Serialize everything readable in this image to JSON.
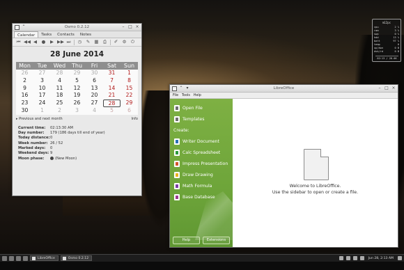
{
  "osmo": {
    "title": "Osmo 0.2.12",
    "tabs": [
      "Calendar",
      "Tasks",
      "Contacts",
      "Notes"
    ],
    "date_heading": "28 June 2014",
    "weekdays": [
      "Mon",
      "Tue",
      "Wed",
      "Thu",
      "Fri",
      "Sat",
      "Sun"
    ],
    "weeks": [
      [
        "26",
        "27",
        "28",
        "29",
        "30",
        "31",
        "1"
      ],
      [
        "2",
        "3",
        "4",
        "5",
        "6",
        "7",
        "8"
      ],
      [
        "9",
        "10",
        "11",
        "12",
        "13",
        "14",
        "15"
      ],
      [
        "16",
        "17",
        "18",
        "19",
        "20",
        "21",
        "22"
      ],
      [
        "23",
        "24",
        "25",
        "26",
        "27",
        "28",
        "29"
      ],
      [
        "30",
        "1",
        "2",
        "3",
        "4",
        "5",
        "6"
      ]
    ],
    "prev_next_label": "Previous and next month",
    "info_label": "Info",
    "info": {
      "current_time_label": "Current time:",
      "current_time": "02:13:30 AM",
      "day_number_label": "Day number:",
      "day_number": "179 (186 days till end of year)",
      "today_distance_label": "Today distance:",
      "today_distance": "0",
      "week_number_label": "Week number:",
      "week_number": "26 / 52",
      "marked_days_label": "Marked days:",
      "marked_days": "0",
      "weekend_days_label": "Weekend days:",
      "weekend_days": "9",
      "moon_phase_label": "Moon phase:",
      "moon_phase": "(New Moon)"
    }
  },
  "libreoffice": {
    "title": "LibreOffice",
    "menu": [
      "File",
      "Tools",
      "Help"
    ],
    "sidebar": {
      "open_file": "Open File",
      "templates": "Templates",
      "create_label": "Create:",
      "items": [
        {
          "label": "Writer Document",
          "color": "#2a6fb6"
        },
        {
          "label": "Calc Spreadsheet",
          "color": "#2b9a3c"
        },
        {
          "label": "Impress Presentation",
          "color": "#d2542b"
        },
        {
          "label": "Draw Drawing",
          "color": "#e6b21e"
        },
        {
          "label": "Math Formula",
          "color": "#7a3fa4"
        },
        {
          "label": "Base Database",
          "color": "#9c3c8e"
        }
      ],
      "help_button": "Help",
      "extensions_button": "Extensions"
    },
    "welcome_line1": "Welcome to LibreOffice.",
    "welcome_line2": "Use the sidebar to open or create a file."
  },
  "taskbar": {
    "tasks": [
      "LibreOffice",
      "Osmo 0.2.12"
    ],
    "clock": "Jun 28,  2:13 AM"
  },
  "conky": {
    "title": "m12pc",
    "rows": [
      [
        "cpu",
        "2 %"
      ],
      [
        "ram",
        "3 %"
      ],
      [
        "swp",
        "0 %"
      ],
      [
        "hdd",
        "13 %"
      ],
      [
        "batt",
        "97 %"
      ],
      [
        "temp",
        "0"
      ],
      [
        "up/dwn",
        "0 B"
      ],
      [
        "dsk/rd",
        "0 B"
      ]
    ],
    "clock": "02:13 / 28.06"
  }
}
